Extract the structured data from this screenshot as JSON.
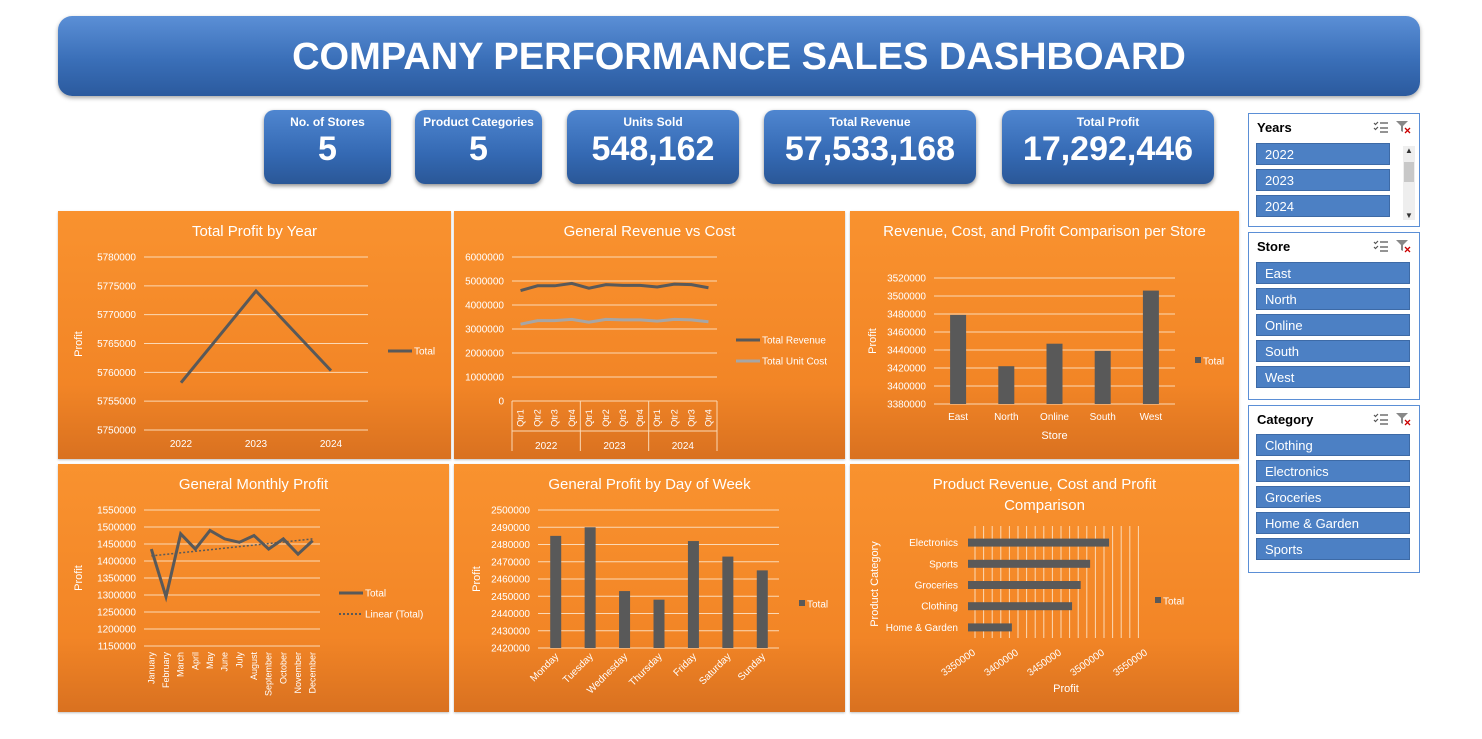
{
  "title": "COMPANY PERFORMANCE SALES DASHBOARD",
  "kpis": [
    {
      "label": "No. of Stores",
      "value": "5"
    },
    {
      "label": "Product Categories",
      "value": "5"
    },
    {
      "label": "Units Sold",
      "value": "548,162"
    },
    {
      "label": "Total Revenue",
      "value": "57,533,168"
    },
    {
      "label": "Total Profit",
      "value": "17,292,446"
    }
  ],
  "slicers": {
    "years": {
      "title": "Years",
      "items": [
        "2022",
        "2023",
        "2024"
      ]
    },
    "store": {
      "title": "Store",
      "items": [
        "East",
        "North",
        "Online",
        "South",
        "West"
      ]
    },
    "category": {
      "title": "Category",
      "items": [
        "Clothing",
        "Electronics",
        "Groceries",
        "Home & Garden",
        "Sports"
      ]
    }
  },
  "colors": {
    "banner": "#3a6fb8",
    "panel": "#f28526",
    "series": "#595959",
    "series2": "#a6a6a6",
    "slicer_item": "#4c80c4"
  },
  "chart_data": [
    {
      "type": "line",
      "title": "Total Profit by Year",
      "ylabel": "Profit",
      "categories": [
        "2022",
        "2023",
        "2024"
      ],
      "series": [
        {
          "name": "Total",
          "values": [
            5758200,
            5774100,
            5760300
          ]
        }
      ],
      "yticks": [
        "5780000",
        "5775000",
        "5770000",
        "5765000",
        "5760000",
        "5755000",
        "5750000"
      ],
      "ylim": [
        5750000,
        5780000
      ],
      "legend": "right"
    },
    {
      "type": "line",
      "title": "General Revenue vs Cost",
      "categories": [
        "Qtr1",
        "Qtr2",
        "Qtr3",
        "Qtr4",
        "Qtr1",
        "Qtr2",
        "Qtr3",
        "Qtr4",
        "Qtr1",
        "Qtr2",
        "Qtr3",
        "Qtr4"
      ],
      "groups": [
        "2022",
        "2023",
        "2024"
      ],
      "series": [
        {
          "name": "Total Revenue",
          "values": [
            4600000,
            4800000,
            4800000,
            4900000,
            4700000,
            4850000,
            4820000,
            4820000,
            4750000,
            4870000,
            4850000,
            4720000
          ]
        },
        {
          "name": "Total Unit Cost",
          "values": [
            3200000,
            3350000,
            3350000,
            3400000,
            3280000,
            3400000,
            3380000,
            3380000,
            3330000,
            3400000,
            3380000,
            3300000
          ]
        }
      ],
      "yticks": [
        "6000000",
        "5000000",
        "4000000",
        "3000000",
        "2000000",
        "1000000",
        "0"
      ],
      "ylim": [
        0,
        6000000
      ],
      "legend": "right"
    },
    {
      "type": "bar",
      "title": "Revenue, Cost, and Profit Comparison per Store",
      "xlabel": "Store",
      "ylabel": "Profit",
      "categories": [
        "East",
        "North",
        "Online",
        "South",
        "West"
      ],
      "series": [
        {
          "name": "Total",
          "values": [
            3479000,
            3422000,
            3447000,
            3439000,
            3506000
          ]
        }
      ],
      "yticks": [
        "3520000",
        "3500000",
        "3480000",
        "3460000",
        "3440000",
        "3420000",
        "3400000",
        "3380000"
      ],
      "ylim": [
        3380000,
        3520000
      ],
      "legend": "right"
    },
    {
      "type": "line",
      "title": "General Monthly Profit",
      "ylabel": "Profit",
      "categories": [
        "January",
        "February",
        "March",
        "April",
        "May",
        "June",
        "July",
        "August",
        "September",
        "October",
        "November",
        "December"
      ],
      "series": [
        {
          "name": "Total",
          "values": [
            1435000,
            1295000,
            1480000,
            1435000,
            1490000,
            1465000,
            1455000,
            1475000,
            1435000,
            1465000,
            1420000,
            1460000
          ]
        },
        {
          "name": "Linear (Total)",
          "values": [
            1415000,
            1465000
          ]
        }
      ],
      "yticks": [
        "1550000",
        "1500000",
        "1450000",
        "1400000",
        "1350000",
        "1300000",
        "1250000",
        "1200000",
        "1150000"
      ],
      "ylim": [
        1150000,
        1550000
      ],
      "legend": "right"
    },
    {
      "type": "bar",
      "title": "General Profit by Day of Week",
      "ylabel": "Profit",
      "categories": [
        "Monday",
        "Tuesday",
        "Wednesday",
        "Thursday",
        "Friday",
        "Saturday",
        "Sunday"
      ],
      "series": [
        {
          "name": "Total",
          "values": [
            2485000,
            2490000,
            2453000,
            2448000,
            2482000,
            2473000,
            2465000
          ]
        }
      ],
      "yticks": [
        "2500000",
        "2490000",
        "2480000",
        "2470000",
        "2460000",
        "2450000",
        "2440000",
        "2430000",
        "2420000"
      ],
      "ylim": [
        2420000,
        2500000
      ],
      "legend": "right"
    },
    {
      "type": "bar",
      "orientation": "horizontal",
      "title": "Product Revenue, Cost and Profit Comparison",
      "xlabel": "Profit",
      "ylabel": "Product Category",
      "categories": [
        "Electronics",
        "Sports",
        "Groceries",
        "Clothing",
        "Home & Garden"
      ],
      "series": [
        {
          "name": "Total",
          "values": [
            3514000,
            3492000,
            3481000,
            3471000,
            3401000
          ]
        }
      ],
      "xticks": [
        "3350000",
        "3400000",
        "3450000",
        "3500000",
        "3550000"
      ],
      "xlim": [
        3350000,
        3550000
      ],
      "legend": "right"
    }
  ]
}
